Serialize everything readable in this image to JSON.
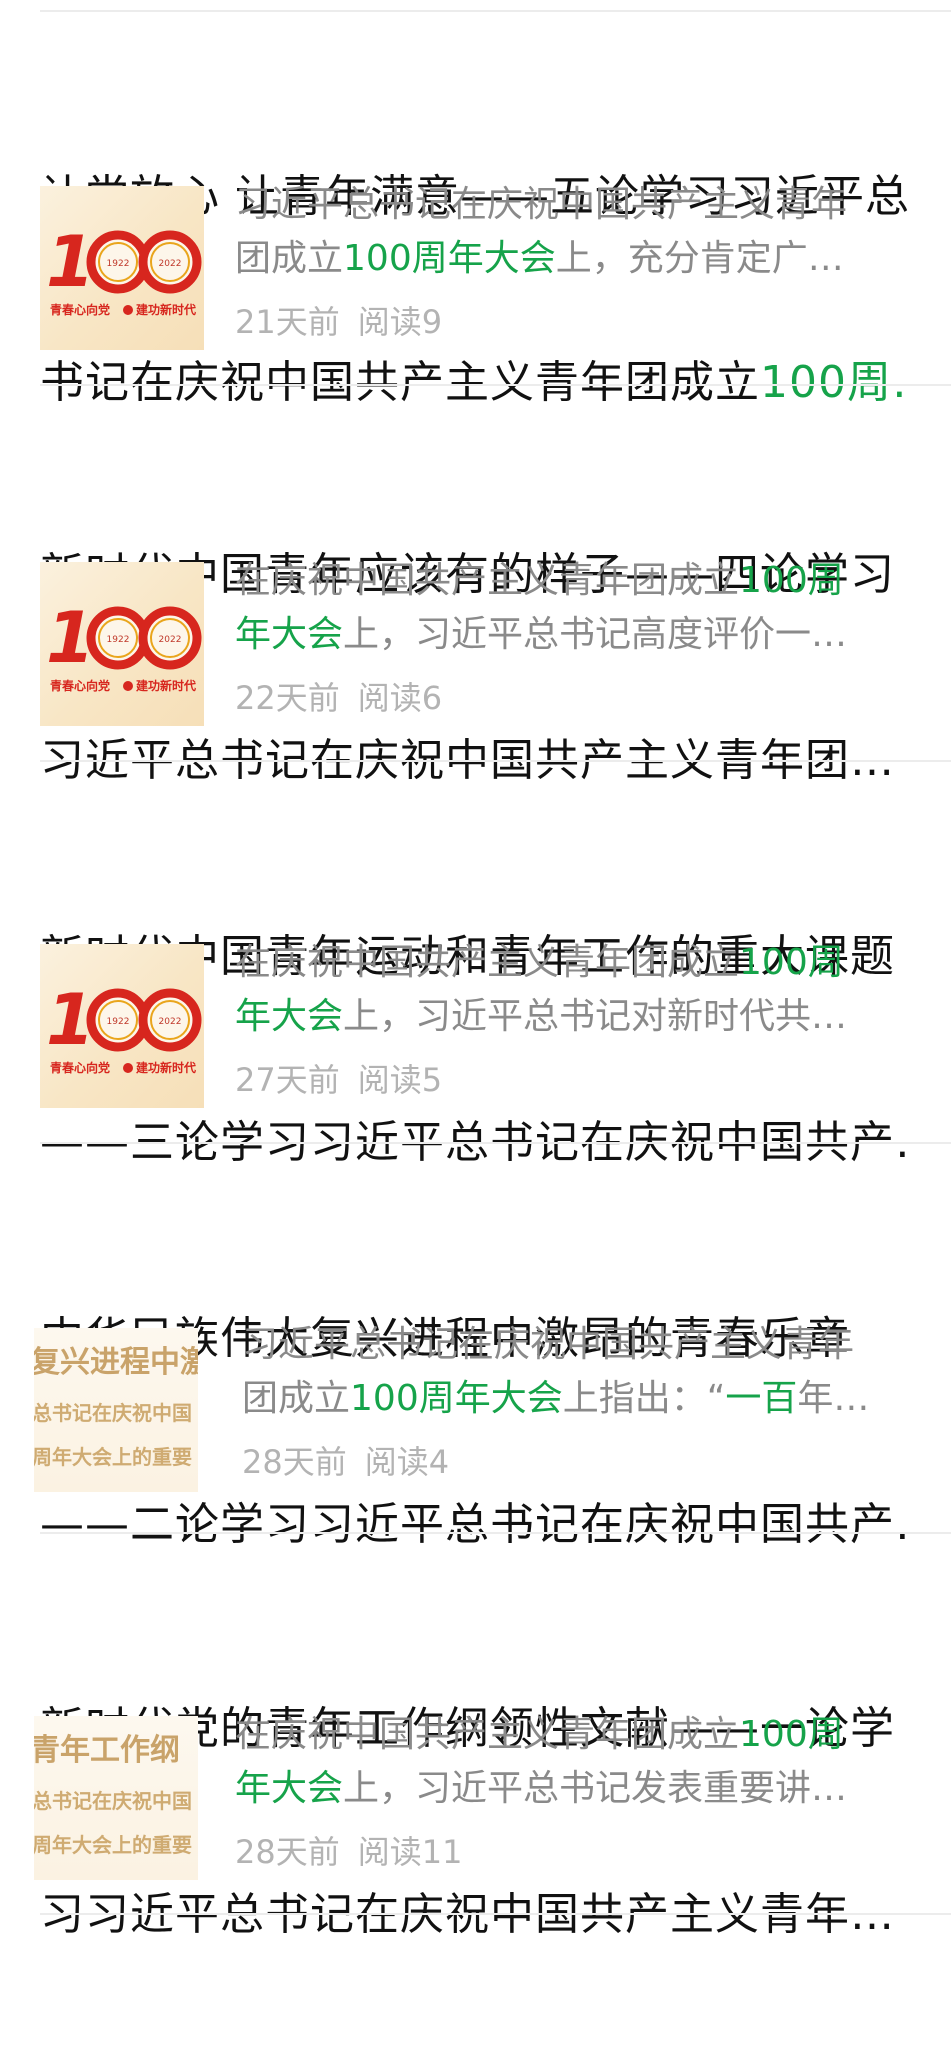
{
  "articles": [
    {
      "title": {
        "line1": "让党放心 让青年满意——五论学习习近平总",
        "line2_pre": "书记在庆祝中国共产主义青年团成立",
        "line2_hl": "100周…"
      },
      "thumbnail": "100-anniversary-logo",
      "summary": {
        "line1_pre": "习近平总书记在庆祝中国共产主义青年",
        "line1_hl": "",
        "line2_pre": "团成立",
        "line2_hl": "100周年大会",
        "line2_post": "上，充分肯定广…"
      },
      "time": "21天前",
      "reads": "阅读9"
    },
    {
      "title": {
        "line1": "新时代中国青年应该有的样子——四论学习",
        "line2_pre": "习近平总书记在庆祝中国共产主义青年团…",
        "line2_hl": ""
      },
      "thumbnail": "100-anniversary-logo",
      "summary": {
        "line1_pre": "在庆祝中国共产主义青年团成立",
        "line1_hl": "100周",
        "line2_pre": "",
        "line2_hl": "年大会",
        "line2_post": "上，习近平总书记高度评价一…"
      },
      "time": "22天前",
      "reads": "阅读6"
    },
    {
      "title": {
        "line1": "新时代中国青年运动和青年工作的重大课题",
        "line2_pre": "——三论学习习近平总书记在庆祝中国共产…",
        "line2_hl": ""
      },
      "thumbnail": "100-anniversary-logo",
      "summary": {
        "line1_pre": "在庆祝中国共产主义青年团成立",
        "line1_hl": "100周",
        "line2_pre": "",
        "line2_hl": "年大会",
        "line2_post": "上，习近平总书记对新时代共…"
      },
      "time": "27天前",
      "reads": "阅读5"
    },
    {
      "title": {
        "line1": "中华民族伟大复兴进程中激昂的青春乐章",
        "line2_pre": "——二论学习习近平总书记在庆祝中国共产…",
        "line2_hl": ""
      },
      "thumbnail": "text-crop",
      "thumb_text": {
        "line1": "复兴进程中激",
        "line2": "总书记在庆祝中国",
        "line3": "周年大会上的重要"
      },
      "summary": {
        "line1_pre": "习近平总书记在庆祝中国共产主义青年",
        "line1_hl": "",
        "line2_pre": "团成立",
        "line2_hl": "100周年大会",
        "line2_post": "上指出：“",
        "line2_hl2": "一百",
        "line2_post2": "年…"
      },
      "time": "28天前",
      "reads": "阅读4"
    },
    {
      "title": {
        "line1": "新时代党的青年工作纲领性文献——一论学",
        "line2_pre": "习习近平总书记在庆祝中国共产主义青年…",
        "line2_hl": ""
      },
      "thumbnail": "text-crop",
      "thumb_text": {
        "line1": "青年工作纲",
        "line2": "总书记在庆祝中国",
        "line3": "周年大会上的重要"
      },
      "summary": {
        "line1_pre": "在庆祝中国共产主义青年团成立",
        "line1_hl": "100周",
        "line2_pre": "",
        "line2_hl": "年大会",
        "line2_post": "上，习近平总书记发表重要讲…"
      },
      "time": "28天前",
      "reads": "阅读11"
    }
  ],
  "logo": {
    "number": "100",
    "year_left": "1922",
    "year_right": "2022",
    "slogan_left": "青春心向党",
    "slogan_right": "建功新时代"
  },
  "colors": {
    "highlight": "#16a34a",
    "title": "#111111",
    "summary": "#8a8a8a",
    "meta": "#b3b3b3",
    "logo_red": "#d7261e",
    "logo_gold": "#e9a51c"
  }
}
